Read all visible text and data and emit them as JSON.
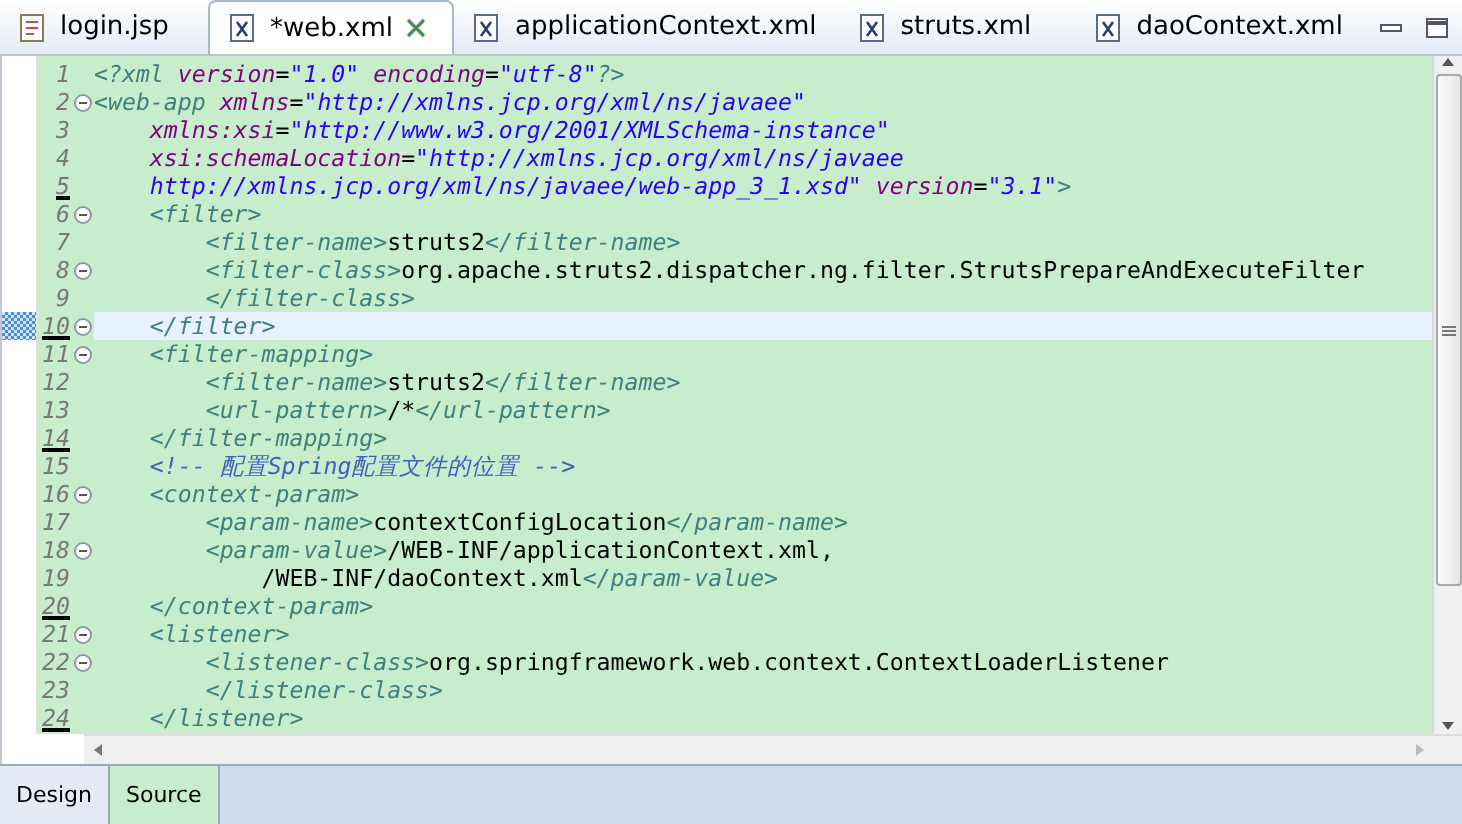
{
  "tabs": [
    {
      "label": "login.jsp",
      "kind": "jsp",
      "selected": false,
      "closable": false
    },
    {
      "label": "*web.xml",
      "kind": "xml",
      "selected": true,
      "closable": true
    },
    {
      "label": "applicationContext.xml",
      "kind": "xml",
      "selected": false,
      "closable": false
    },
    {
      "label": "struts.xml",
      "kind": "xml",
      "selected": false,
      "closable": false
    },
    {
      "label": "daoContext.xml",
      "kind": "xml",
      "selected": false,
      "closable": false
    }
  ],
  "editor": {
    "lines": [
      {
        "number": "1",
        "foldable": false,
        "marked": false,
        "current": false,
        "tokens": [
          {
            "kind": "pi",
            "text": "<?xml"
          },
          {
            "kind": "attr",
            "text": " version"
          },
          {
            "kind": "text",
            "text": "="
          },
          {
            "kind": "string",
            "text": "\"1.0\""
          },
          {
            "kind": "attr",
            "text": " encoding"
          },
          {
            "kind": "text",
            "text": "="
          },
          {
            "kind": "string",
            "text": "\"utf-8\""
          },
          {
            "kind": "pi",
            "text": "?>"
          }
        ]
      },
      {
        "number": "2",
        "foldable": true,
        "marked": false,
        "current": false,
        "tokens": [
          {
            "kind": "tag",
            "text": "<web-app"
          },
          {
            "kind": "attr",
            "text": " xmlns"
          },
          {
            "kind": "text",
            "text": "="
          },
          {
            "kind": "string",
            "text": "\"http://xmlns.jcp.org/xml/ns/javaee\""
          }
        ]
      },
      {
        "number": "3",
        "foldable": false,
        "marked": false,
        "current": false,
        "tokens": [
          {
            "kind": "attr",
            "text": "    xmlns:xsi"
          },
          {
            "kind": "text",
            "text": "="
          },
          {
            "kind": "string",
            "text": "\"http://www.w3.org/2001/XMLSchema-instance\""
          }
        ]
      },
      {
        "number": "4",
        "foldable": false,
        "marked": false,
        "current": false,
        "tokens": [
          {
            "kind": "attr",
            "text": "    xsi:schemaLocation"
          },
          {
            "kind": "text",
            "text": "="
          },
          {
            "kind": "string",
            "text": "\"http://xmlns.jcp.org/xml/ns/javaee"
          }
        ]
      },
      {
        "number": "5",
        "foldable": false,
        "marked": true,
        "current": false,
        "tokens": [
          {
            "kind": "string",
            "text": "    http://xmlns.jcp.org/xml/ns/javaee/web-app_3_1.xsd\""
          },
          {
            "kind": "attr",
            "text": " version"
          },
          {
            "kind": "text",
            "text": "="
          },
          {
            "kind": "string",
            "text": "\"3.1\""
          },
          {
            "kind": "tag",
            "text": ">"
          }
        ]
      },
      {
        "number": "6",
        "foldable": true,
        "marked": false,
        "current": false,
        "tokens": [
          {
            "kind": "tag",
            "text": "    <filter>"
          }
        ]
      },
      {
        "number": "7",
        "foldable": false,
        "marked": false,
        "current": false,
        "tokens": [
          {
            "kind": "tag",
            "text": "        <filter-name>"
          },
          {
            "kind": "text",
            "text": "struts2"
          },
          {
            "kind": "tag",
            "text": "</filter-name>"
          }
        ]
      },
      {
        "number": "8",
        "foldable": true,
        "marked": false,
        "current": false,
        "tokens": [
          {
            "kind": "tag",
            "text": "        <filter-class>"
          },
          {
            "kind": "text",
            "text": "org.apache.struts2.dispatcher.ng.filter.StrutsPrepareAndExecuteFilter"
          }
        ]
      },
      {
        "number": "9",
        "foldable": false,
        "marked": false,
        "current": false,
        "tokens": [
          {
            "kind": "tag",
            "text": "        </filter-class>"
          }
        ]
      },
      {
        "number": "10",
        "foldable": true,
        "marked": true,
        "current": true,
        "tokens": [
          {
            "kind": "tag",
            "text": "    </filter>"
          }
        ]
      },
      {
        "number": "11",
        "foldable": true,
        "marked": false,
        "current": false,
        "tokens": [
          {
            "kind": "tag",
            "text": "    <filter-mapping>"
          }
        ]
      },
      {
        "number": "12",
        "foldable": false,
        "marked": false,
        "current": false,
        "tokens": [
          {
            "kind": "tag",
            "text": "        <filter-name>"
          },
          {
            "kind": "text",
            "text": "struts2"
          },
          {
            "kind": "tag",
            "text": "</filter-name>"
          }
        ]
      },
      {
        "number": "13",
        "foldable": false,
        "marked": false,
        "current": false,
        "tokens": [
          {
            "kind": "tag",
            "text": "        <url-pattern>"
          },
          {
            "kind": "text",
            "text": "/*"
          },
          {
            "kind": "tag",
            "text": "</url-pattern>"
          }
        ]
      },
      {
        "number": "14",
        "foldable": false,
        "marked": true,
        "current": false,
        "tokens": [
          {
            "kind": "tag",
            "text": "    </filter-mapping>"
          }
        ]
      },
      {
        "number": "15",
        "foldable": false,
        "marked": false,
        "current": false,
        "tokens": [
          {
            "kind": "comment",
            "text": "    <!-- 配置Spring配置文件的位置 -->"
          }
        ]
      },
      {
        "number": "16",
        "foldable": true,
        "marked": false,
        "current": false,
        "tokens": [
          {
            "kind": "tag",
            "text": "    <context-param>"
          }
        ]
      },
      {
        "number": "17",
        "foldable": false,
        "marked": false,
        "current": false,
        "tokens": [
          {
            "kind": "tag",
            "text": "        <param-name>"
          },
          {
            "kind": "text",
            "text": "contextConfigLocation"
          },
          {
            "kind": "tag",
            "text": "</param-name>"
          }
        ]
      },
      {
        "number": "18",
        "foldable": true,
        "marked": false,
        "current": false,
        "tokens": [
          {
            "kind": "tag",
            "text": "        <param-value>"
          },
          {
            "kind": "text",
            "text": "/WEB-INF/applicationContext.xml,"
          }
        ]
      },
      {
        "number": "19",
        "foldable": false,
        "marked": false,
        "current": false,
        "tokens": [
          {
            "kind": "text",
            "text": "            /WEB-INF/daoContext.xml"
          },
          {
            "kind": "tag",
            "text": "</param-value>"
          }
        ]
      },
      {
        "number": "20",
        "foldable": false,
        "marked": true,
        "current": false,
        "tokens": [
          {
            "kind": "tag",
            "text": "    </context-param>"
          }
        ]
      },
      {
        "number": "21",
        "foldable": true,
        "marked": false,
        "current": false,
        "tokens": [
          {
            "kind": "tag",
            "text": "    <listener>"
          }
        ]
      },
      {
        "number": "22",
        "foldable": true,
        "marked": false,
        "current": false,
        "tokens": [
          {
            "kind": "tag",
            "text": "        <listener-class>"
          },
          {
            "kind": "text",
            "text": "org.springframework.web.context.ContextLoaderListener"
          }
        ]
      },
      {
        "number": "23",
        "foldable": false,
        "marked": false,
        "current": false,
        "tokens": [
          {
            "kind": "tag",
            "text": "        </listener-class>"
          }
        ]
      },
      {
        "number": "24",
        "foldable": false,
        "marked": true,
        "current": false,
        "tokens": [
          {
            "kind": "tag",
            "text": "    </listener>"
          }
        ]
      }
    ]
  },
  "bottom_tabs": [
    {
      "label": "Design",
      "selected": false
    },
    {
      "label": "Source",
      "selected": true
    }
  ]
}
